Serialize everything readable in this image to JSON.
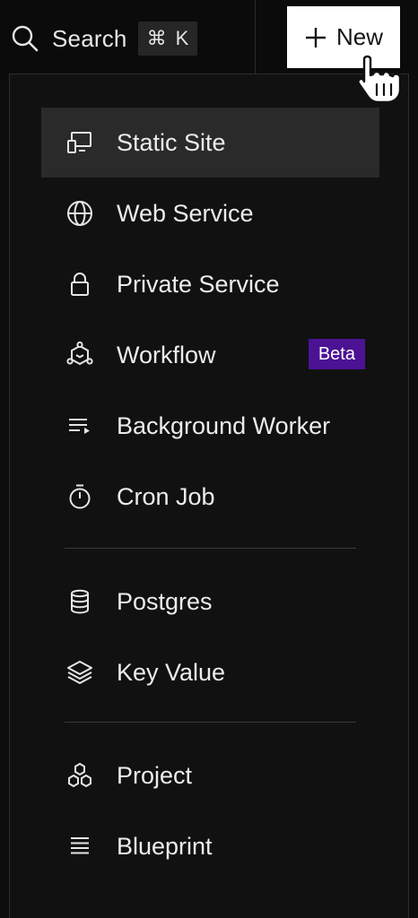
{
  "topbar": {
    "search_label": "Search",
    "shortcut_symbol": "⌘",
    "shortcut_key": "K",
    "new_label": "New"
  },
  "menu": {
    "items": [
      {
        "label": "Static Site",
        "icon": "static-site-icon",
        "active": true
      },
      {
        "label": "Web Service",
        "icon": "globe-icon"
      },
      {
        "label": "Private Service",
        "icon": "lock-icon"
      },
      {
        "label": "Workflow",
        "icon": "workflow-icon",
        "badge": "Beta"
      },
      {
        "label": "Background Worker",
        "icon": "background-worker-icon"
      },
      {
        "label": "Cron Job",
        "icon": "stopwatch-icon"
      },
      {
        "label": "Postgres",
        "icon": "database-icon"
      },
      {
        "label": "Key Value",
        "icon": "layers-icon"
      },
      {
        "label": "Project",
        "icon": "project-icon"
      },
      {
        "label": "Blueprint",
        "icon": "blueprint-icon"
      }
    ]
  },
  "colors": {
    "background": "#0c0c0c",
    "menu_background": "#111111",
    "active_item": "#2a2a2a",
    "badge": "#4b1293",
    "new_button": "#ffffff"
  }
}
